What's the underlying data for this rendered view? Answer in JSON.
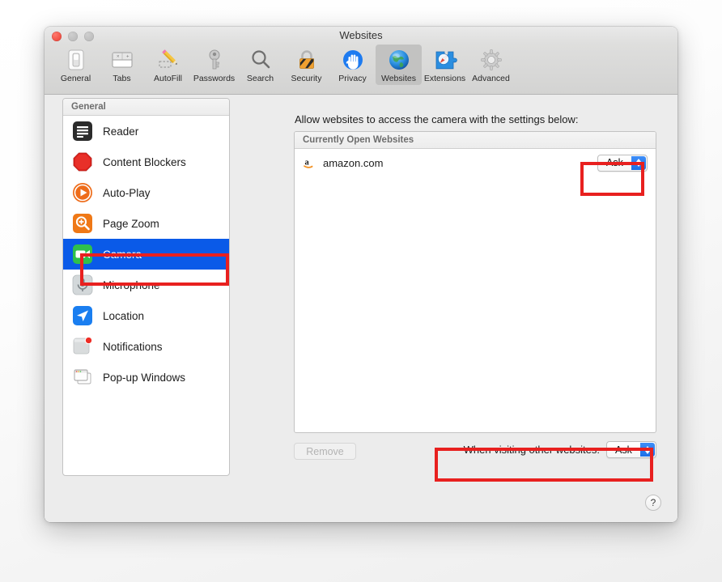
{
  "window": {
    "title": "Websites",
    "traffic_lights": [
      "close",
      "minimize",
      "zoom"
    ]
  },
  "toolbar": {
    "items": [
      {
        "label": "General",
        "icon": "general-icon",
        "selected": false
      },
      {
        "label": "Tabs",
        "icon": "tabs-icon",
        "selected": false
      },
      {
        "label": "AutoFill",
        "icon": "autofill-icon",
        "selected": false
      },
      {
        "label": "Passwords",
        "icon": "key-icon",
        "selected": false
      },
      {
        "label": "Search",
        "icon": "search-icon",
        "selected": false
      },
      {
        "label": "Security",
        "icon": "lock-icon",
        "selected": false
      },
      {
        "label": "Privacy",
        "icon": "hand-icon",
        "selected": false
      },
      {
        "label": "Websites",
        "icon": "globe-icon",
        "selected": true
      },
      {
        "label": "Extensions",
        "icon": "puzzle-icon",
        "selected": false
      },
      {
        "label": "Advanced",
        "icon": "gear-icon",
        "selected": false
      }
    ]
  },
  "sidebar": {
    "header": "General",
    "items": [
      {
        "label": "Reader",
        "icon": "reader-icon",
        "selected": false
      },
      {
        "label": "Content Blockers",
        "icon": "stop-sign-icon",
        "selected": false
      },
      {
        "label": "Auto-Play",
        "icon": "play-circle-icon",
        "selected": false
      },
      {
        "label": "Page Zoom",
        "icon": "magnifier-plus-icon",
        "selected": false
      },
      {
        "label": "Camera",
        "icon": "camera-icon",
        "selected": true
      },
      {
        "label": "Microphone",
        "icon": "microphone-icon",
        "selected": false
      },
      {
        "label": "Location",
        "icon": "location-arrow-icon",
        "selected": false
      },
      {
        "label": "Notifications",
        "icon": "notification-badge-icon",
        "selected": false
      },
      {
        "label": "Pop-up Windows",
        "icon": "popup-windows-icon",
        "selected": false
      }
    ]
  },
  "main": {
    "description": "Allow websites to access the camera with the settings below:",
    "list_header": "Currently Open Websites",
    "rows": [
      {
        "favicon": "amazon-favicon",
        "site": "amazon.com",
        "permission": "Ask"
      }
    ],
    "remove_label": "Remove",
    "remove_enabled": false,
    "other_sites_label": "When visiting other websites:",
    "other_sites_value": "Ask",
    "help_label": "?"
  },
  "colors": {
    "selection_blue": "#0a5ae8",
    "annotation_red": "#e8201f",
    "popup_arrow_blue": "#1b6fe8",
    "window_bg": "#ececec"
  }
}
